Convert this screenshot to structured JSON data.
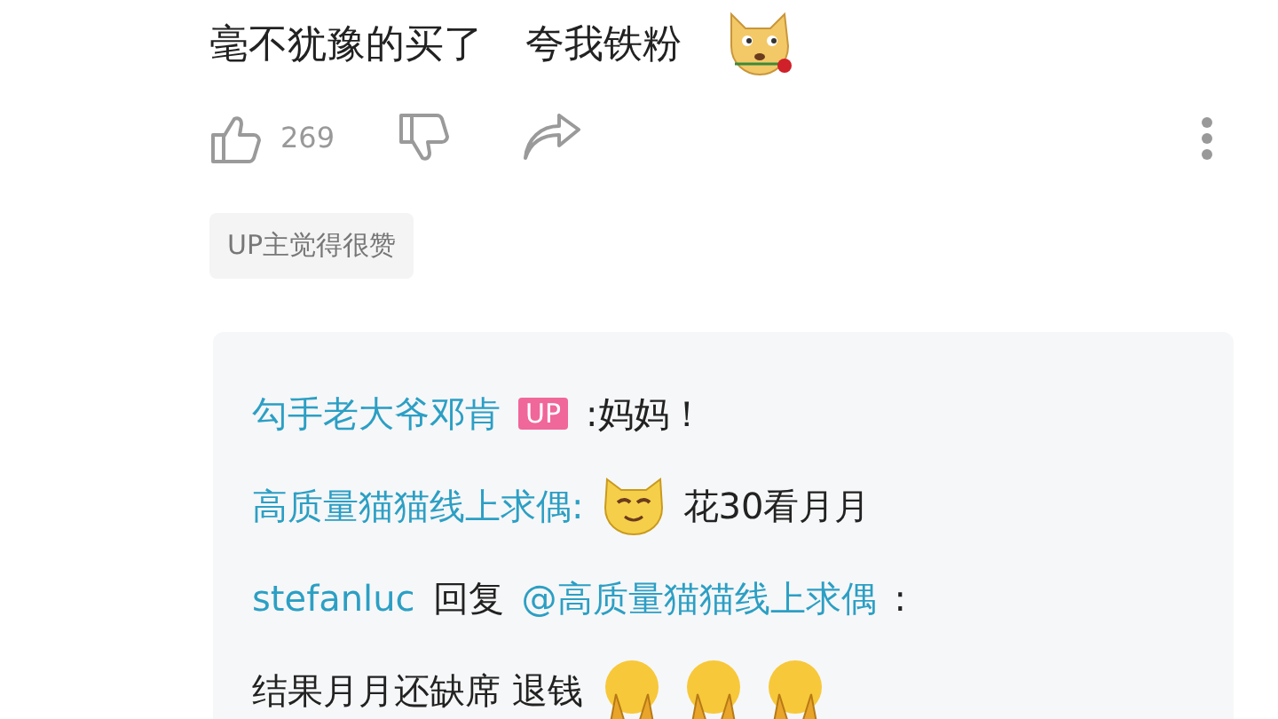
{
  "comment": {
    "segments": [
      {
        "kind": "text",
        "text": "毫不犹豫的买了"
      },
      {
        "kind": "text",
        "text": "夸我铁粉"
      },
      {
        "kind": "dog_rose"
      }
    ],
    "likes": "269",
    "tag": "UP主觉得很赞"
  },
  "replies": [
    {
      "segments": [
        {
          "kind": "author",
          "text": "勾手老大爷邓肯"
        },
        {
          "kind": "badge",
          "text": "UP"
        },
        {
          "kind": "text",
          "text": ":妈妈！"
        }
      ]
    },
    {
      "segments": [
        {
          "kind": "author",
          "text": "高质量猫猫线上求偶:"
        },
        {
          "kind": "cat_face"
        },
        {
          "kind": "text",
          "text": "花30看月月"
        }
      ]
    },
    {
      "segments": [
        {
          "kind": "author",
          "text": "stefanluc"
        },
        {
          "kind": "text",
          "text": "回复"
        },
        {
          "kind": "mention",
          "text": "@高质量猫猫线上求偶"
        },
        {
          "kind": "text",
          "text": ":"
        }
      ],
      "body": [
        {
          "kind": "text",
          "text": "结果月月还缺席 退钱"
        },
        {
          "kind": "covered_face"
        },
        {
          "kind": "covered_face"
        },
        {
          "kind": "covered_face"
        }
      ]
    }
  ]
}
